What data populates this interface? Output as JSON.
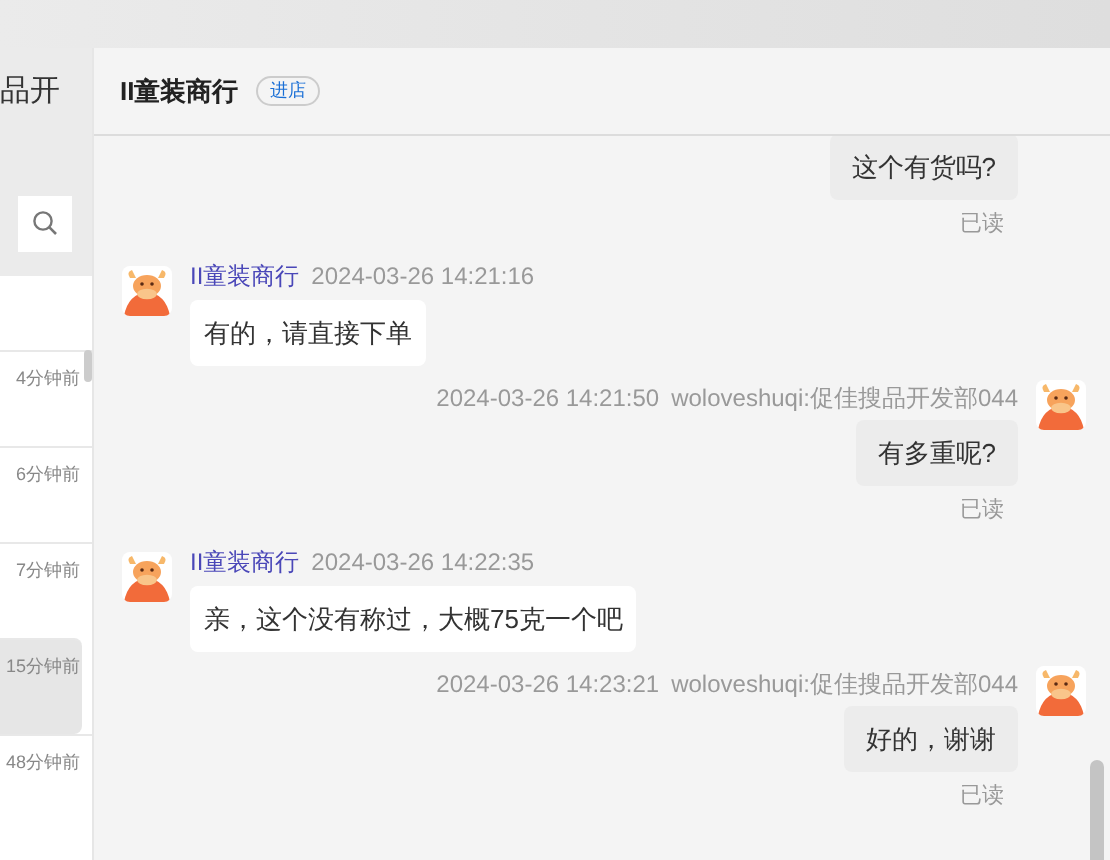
{
  "side_panel": {
    "title_fragment": "品开",
    "conversations": [
      {
        "time": "4分钟前",
        "selected": false
      },
      {
        "time": "6分钟前",
        "selected": false
      },
      {
        "time": "7分钟前",
        "selected": false
      },
      {
        "time": "15分钟前",
        "selected": true
      },
      {
        "time": "48分钟前",
        "selected": false
      }
    ]
  },
  "chat": {
    "title": "II童装商行",
    "badge": "进店",
    "messages": [
      {
        "kind": "outgoing",
        "text": "这个有货吗?",
        "status": "已读"
      },
      {
        "kind": "incoming",
        "sender": "II童装商行",
        "time": "2024-03-26 14:21:16",
        "text": "有的，请直接下单"
      },
      {
        "kind": "outgoing",
        "time": "2024-03-26 14:21:50",
        "sender": "woloveshuqi:促佳搜品开发部044",
        "text": "有多重呢?",
        "status": "已读"
      },
      {
        "kind": "incoming",
        "sender": "II童装商行",
        "time": "2024-03-26 14:22:35",
        "text": "亲，这个没有称过，大概75克一个吧"
      },
      {
        "kind": "outgoing",
        "time": "2024-03-26 14:23:21",
        "sender": "woloveshuqi:促佳搜品开发部044",
        "text": "好的，谢谢",
        "status": "已读"
      }
    ]
  }
}
